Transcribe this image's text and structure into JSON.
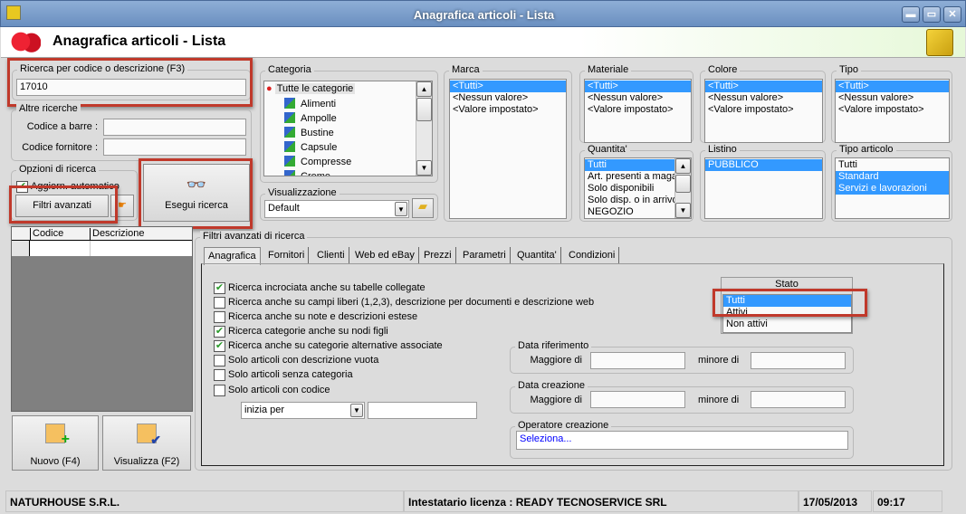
{
  "window": {
    "title": "Anagrafica articoli  - Lista",
    "minimize": "▬",
    "maximize": "▭",
    "close": "✕"
  },
  "header": {
    "title": "Anagrafica articoli  - Lista"
  },
  "search": {
    "label": "Ricerca per codice o descrizione (F3)",
    "value": "17010"
  },
  "other": {
    "label": "Altre ricerche",
    "barcode_label": "Codice a barre :",
    "barcode_value": "",
    "supplier_label": "Codice fornitore :",
    "supplier_value": ""
  },
  "options": {
    "label": "Opzioni di ricerca",
    "auto_update": "Aggiorn. automatico",
    "auto_update_checked": true,
    "advanced_filters": "Filtri avanzati",
    "search_button": "Esegui ricerca"
  },
  "grid": {
    "columns": [
      "Codice",
      "Descrizione"
    ]
  },
  "actions": {
    "new": "Nuovo (F4)",
    "view": "Visualizza (F2)"
  },
  "categoria": {
    "label": "Categoria",
    "items": [
      "Tutte le categorie",
      "Alimenti",
      "Ampolle",
      "Bustine",
      "Capsule",
      "Compresse",
      "Creme"
    ]
  },
  "visualizzazione": {
    "label": "Visualizzazione",
    "value": "Default"
  },
  "marca": {
    "label": "Marca",
    "items": [
      "<Tutti>",
      "<Nessun valore>",
      "<Valore impostato>"
    ]
  },
  "materiale": {
    "label": "Materiale",
    "items": [
      "<Tutti>",
      "<Nessun valore>",
      "<Valore impostato>"
    ]
  },
  "colore": {
    "label": "Colore",
    "items": [
      "<Tutti>",
      "<Nessun valore>",
      "<Valore impostato>"
    ]
  },
  "tipo": {
    "label": "Tipo",
    "items": [
      "<Tutti>",
      "<Nessun valore>",
      "<Valore impostato>"
    ]
  },
  "quantita": {
    "label": "Quantita'",
    "items": [
      "Tutti",
      "Art. presenti a magazzino",
      "Solo disponibili",
      "Solo disp. o in arrivo",
      "NEGOZIO"
    ]
  },
  "listino": {
    "label": "Listino",
    "items": [
      "PUBBLICO"
    ]
  },
  "tipo_articolo": {
    "label": "Tipo articolo",
    "items": [
      "Tutti",
      "Standard",
      "Servizi e lavorazioni"
    ]
  },
  "advanced": {
    "label": "Filtri avanzati di ricerca",
    "tabs": [
      "Anagrafica",
      "Fornitori",
      "Clienti",
      "Web ed eBay",
      "Prezzi",
      "Parametri",
      "Quantita'",
      "Condizioni"
    ],
    "checks": [
      {
        "label": "Ricerca incrociata anche su tabelle collegate",
        "checked": true
      },
      {
        "label": "Ricerca anche su campi liberi (1,2,3), descrizione per documenti e descrizione web",
        "checked": false
      },
      {
        "label": "Ricerca anche su note e descrizioni estese",
        "checked": false
      },
      {
        "label": "Ricerca categorie anche su nodi figli",
        "checked": true
      },
      {
        "label": "Ricerca anche su categorie alternative associate",
        "checked": true
      },
      {
        "label": "Solo articoli con descrizione vuota",
        "checked": false
      },
      {
        "label": "Solo articoli senza categoria",
        "checked": false
      },
      {
        "label": "Solo articoli con codice",
        "checked": false
      }
    ],
    "code_mode": "inizia per",
    "code_value": "",
    "stato": {
      "label": "Stato",
      "items": [
        "Tutti",
        "Attivi",
        "Non attivi"
      ]
    },
    "data_rif": {
      "label": "Data riferimento",
      "greater": "Maggiore di",
      "less": "minore di"
    },
    "data_cre": {
      "label": "Data creazione",
      "greater": "Maggiore di",
      "less": "minore di"
    },
    "operatore": {
      "label": "Operatore creazione",
      "value": "Seleziona..."
    }
  },
  "status": {
    "company": "NATURHOUSE S.R.L.",
    "license": "Intestatario licenza : READY TECNOSERVICE SRL",
    "date": "17/05/2013",
    "time": "09:17"
  },
  "colors": {
    "selection": "#3399ff",
    "highlight": "#c0392b",
    "link": "#0000ff"
  }
}
